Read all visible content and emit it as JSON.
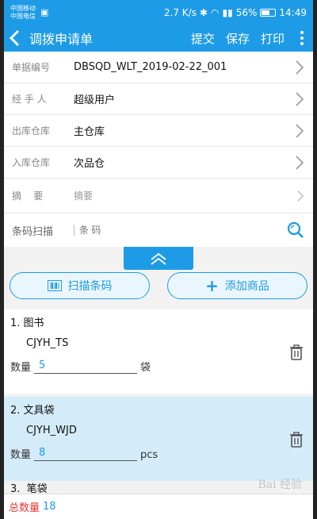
{
  "status": {
    "carrier1": "中国移动",
    "carrier2": "中国电信",
    "speed": "2.7 K/s",
    "battery": "56%",
    "time": "14:49"
  },
  "appbar": {
    "title": "调拨申请单",
    "submit": "提交",
    "save": "保存",
    "print": "打印"
  },
  "form": {
    "doc_no_label": "单据编号",
    "doc_no": "DBSQD_WLT_2019-02-22_001",
    "handler_label": "经 手 人",
    "handler": "超级用户",
    "out_wh_label": "出库仓库",
    "out_wh": "主仓库",
    "in_wh_label": "入库仓库",
    "in_wh": "次品仓",
    "summary_label": "摘    要",
    "summary_placeholder": "摘要",
    "scan_label": "条码扫描",
    "scan_placeholder": "条 码"
  },
  "buttons": {
    "scan": "扫描条码",
    "add": "添加商品"
  },
  "items": [
    {
      "index": "1.",
      "name": "图书",
      "code": "CJYH_TS",
      "qty_label": "数量",
      "qty": "5",
      "unit": "袋"
    },
    {
      "index": "2.",
      "name": "文具袋",
      "code": "CJYH_WJD",
      "qty_label": "数量",
      "qty": "8",
      "unit": "pcs"
    }
  ],
  "peek_item": "3.  笔袋",
  "footer": {
    "total_label": "总数量",
    "total": "18"
  },
  "watermark": "Bai 经验"
}
